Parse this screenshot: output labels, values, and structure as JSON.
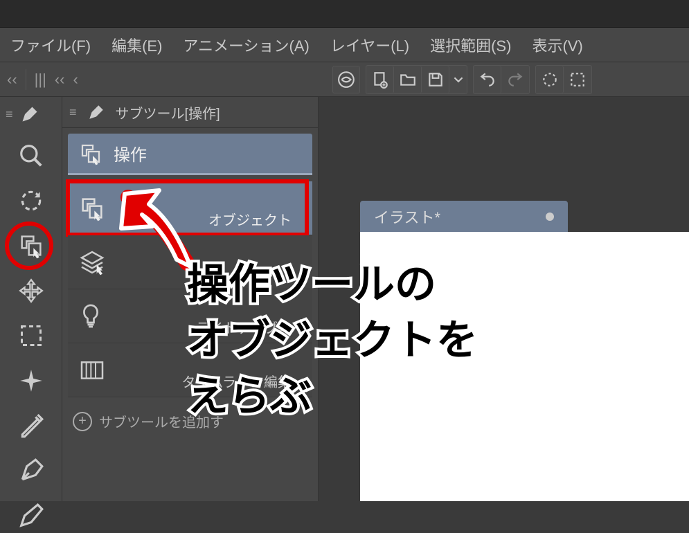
{
  "menu": {
    "file": "ファイル(F)",
    "edit": "編集(E)",
    "animation": "アニメーション(A)",
    "layer": "レイヤー(L)",
    "selection": "選択範囲(S)",
    "view": "表示(V)"
  },
  "subtool": {
    "header": "サブツール[操作]",
    "tab": "操作",
    "items": {
      "object": "オブジェクト",
      "light_table": "ライトテーブル",
      "timeline_edit": "タイムライン編集"
    },
    "footer": "サブツールを追加す"
  },
  "document": {
    "tab": "イラスト*"
  },
  "annotation": {
    "line1": "操作ツールの",
    "line2": "オブジェクトを",
    "line3": "えらぶ"
  }
}
